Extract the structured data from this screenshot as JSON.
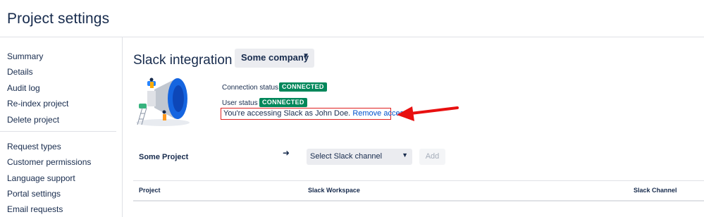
{
  "header": {
    "title": "Project settings"
  },
  "sidebar": {
    "group1": [
      {
        "label": "Summary"
      },
      {
        "label": "Details"
      },
      {
        "label": "Audit log"
      },
      {
        "label": "Re-index project"
      },
      {
        "label": "Delete project"
      }
    ],
    "group2": [
      {
        "label": "Request types"
      },
      {
        "label": "Customer permissions"
      },
      {
        "label": "Language support"
      },
      {
        "label": "Portal settings"
      },
      {
        "label": "Email requests"
      }
    ]
  },
  "slack": {
    "title": "Slack integration",
    "company_select": "Some company",
    "connection_label": "Connection status",
    "connection_badge": "CONNECTED",
    "user_label": "User status",
    "user_badge": "CONNECTED",
    "access_text": "You're accessing Slack as John Doe.",
    "remove_link": "Remove access."
  },
  "mapping": {
    "project": "Some Project",
    "arrow": "➜",
    "channel_placeholder": "Select Slack channel",
    "add_label": "Add"
  },
  "table": {
    "columns": [
      "Project",
      "Slack Workspace",
      "Slack Channel"
    ]
  },
  "colors": {
    "badge": "#00875a",
    "link": "#0052cc",
    "highlight": "#e02020"
  }
}
